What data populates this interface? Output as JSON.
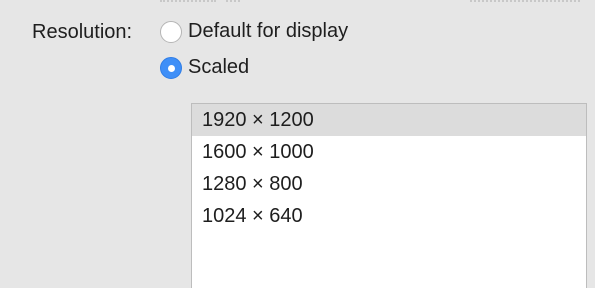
{
  "resolution": {
    "label": "Resolution:",
    "options": [
      {
        "label": "Default for display",
        "selected": false
      },
      {
        "label": "Scaled",
        "selected": true
      }
    ]
  },
  "scaled_list": {
    "items": [
      "1920 × 1200",
      "1600 × 1000",
      "1280 × 800",
      "1024 × 640"
    ],
    "selected_index": 0
  }
}
